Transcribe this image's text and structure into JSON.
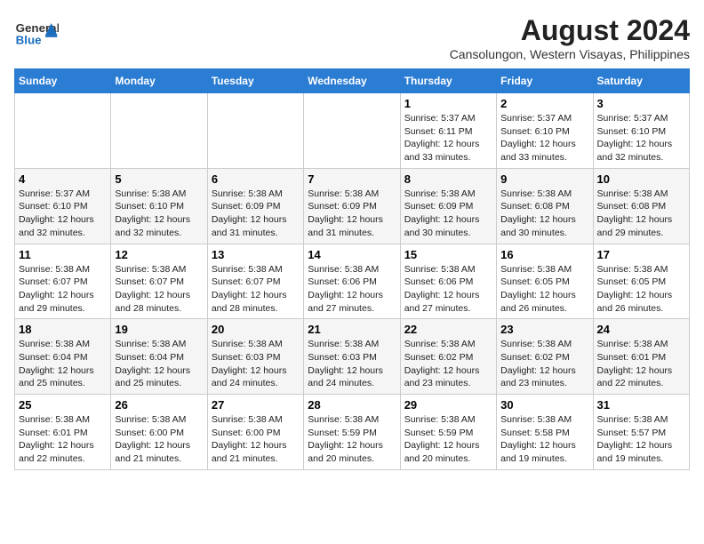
{
  "header": {
    "logo_general": "General",
    "logo_blue": "Blue",
    "month_year": "August 2024",
    "location": "Cansolungon, Western Visayas, Philippines"
  },
  "weekdays": [
    "Sunday",
    "Monday",
    "Tuesday",
    "Wednesday",
    "Thursday",
    "Friday",
    "Saturday"
  ],
  "weeks": [
    [
      {
        "day": "",
        "info": ""
      },
      {
        "day": "",
        "info": ""
      },
      {
        "day": "",
        "info": ""
      },
      {
        "day": "",
        "info": ""
      },
      {
        "day": "1",
        "info": "Sunrise: 5:37 AM\nSunset: 6:11 PM\nDaylight: 12 hours\nand 33 minutes."
      },
      {
        "day": "2",
        "info": "Sunrise: 5:37 AM\nSunset: 6:10 PM\nDaylight: 12 hours\nand 33 minutes."
      },
      {
        "day": "3",
        "info": "Sunrise: 5:37 AM\nSunset: 6:10 PM\nDaylight: 12 hours\nand 32 minutes."
      }
    ],
    [
      {
        "day": "4",
        "info": "Sunrise: 5:37 AM\nSunset: 6:10 PM\nDaylight: 12 hours\nand 32 minutes."
      },
      {
        "day": "5",
        "info": "Sunrise: 5:38 AM\nSunset: 6:10 PM\nDaylight: 12 hours\nand 32 minutes."
      },
      {
        "day": "6",
        "info": "Sunrise: 5:38 AM\nSunset: 6:09 PM\nDaylight: 12 hours\nand 31 minutes."
      },
      {
        "day": "7",
        "info": "Sunrise: 5:38 AM\nSunset: 6:09 PM\nDaylight: 12 hours\nand 31 minutes."
      },
      {
        "day": "8",
        "info": "Sunrise: 5:38 AM\nSunset: 6:09 PM\nDaylight: 12 hours\nand 30 minutes."
      },
      {
        "day": "9",
        "info": "Sunrise: 5:38 AM\nSunset: 6:08 PM\nDaylight: 12 hours\nand 30 minutes."
      },
      {
        "day": "10",
        "info": "Sunrise: 5:38 AM\nSunset: 6:08 PM\nDaylight: 12 hours\nand 29 minutes."
      }
    ],
    [
      {
        "day": "11",
        "info": "Sunrise: 5:38 AM\nSunset: 6:07 PM\nDaylight: 12 hours\nand 29 minutes."
      },
      {
        "day": "12",
        "info": "Sunrise: 5:38 AM\nSunset: 6:07 PM\nDaylight: 12 hours\nand 28 minutes."
      },
      {
        "day": "13",
        "info": "Sunrise: 5:38 AM\nSunset: 6:07 PM\nDaylight: 12 hours\nand 28 minutes."
      },
      {
        "day": "14",
        "info": "Sunrise: 5:38 AM\nSunset: 6:06 PM\nDaylight: 12 hours\nand 27 minutes."
      },
      {
        "day": "15",
        "info": "Sunrise: 5:38 AM\nSunset: 6:06 PM\nDaylight: 12 hours\nand 27 minutes."
      },
      {
        "day": "16",
        "info": "Sunrise: 5:38 AM\nSunset: 6:05 PM\nDaylight: 12 hours\nand 26 minutes."
      },
      {
        "day": "17",
        "info": "Sunrise: 5:38 AM\nSunset: 6:05 PM\nDaylight: 12 hours\nand 26 minutes."
      }
    ],
    [
      {
        "day": "18",
        "info": "Sunrise: 5:38 AM\nSunset: 6:04 PM\nDaylight: 12 hours\nand 25 minutes."
      },
      {
        "day": "19",
        "info": "Sunrise: 5:38 AM\nSunset: 6:04 PM\nDaylight: 12 hours\nand 25 minutes."
      },
      {
        "day": "20",
        "info": "Sunrise: 5:38 AM\nSunset: 6:03 PM\nDaylight: 12 hours\nand 24 minutes."
      },
      {
        "day": "21",
        "info": "Sunrise: 5:38 AM\nSunset: 6:03 PM\nDaylight: 12 hours\nand 24 minutes."
      },
      {
        "day": "22",
        "info": "Sunrise: 5:38 AM\nSunset: 6:02 PM\nDaylight: 12 hours\nand 23 minutes."
      },
      {
        "day": "23",
        "info": "Sunrise: 5:38 AM\nSunset: 6:02 PM\nDaylight: 12 hours\nand 23 minutes."
      },
      {
        "day": "24",
        "info": "Sunrise: 5:38 AM\nSunset: 6:01 PM\nDaylight: 12 hours\nand 22 minutes."
      }
    ],
    [
      {
        "day": "25",
        "info": "Sunrise: 5:38 AM\nSunset: 6:01 PM\nDaylight: 12 hours\nand 22 minutes."
      },
      {
        "day": "26",
        "info": "Sunrise: 5:38 AM\nSunset: 6:00 PM\nDaylight: 12 hours\nand 21 minutes."
      },
      {
        "day": "27",
        "info": "Sunrise: 5:38 AM\nSunset: 6:00 PM\nDaylight: 12 hours\nand 21 minutes."
      },
      {
        "day": "28",
        "info": "Sunrise: 5:38 AM\nSunset: 5:59 PM\nDaylight: 12 hours\nand 20 minutes."
      },
      {
        "day": "29",
        "info": "Sunrise: 5:38 AM\nSunset: 5:59 PM\nDaylight: 12 hours\nand 20 minutes."
      },
      {
        "day": "30",
        "info": "Sunrise: 5:38 AM\nSunset: 5:58 PM\nDaylight: 12 hours\nand 19 minutes."
      },
      {
        "day": "31",
        "info": "Sunrise: 5:38 AM\nSunset: 5:57 PM\nDaylight: 12 hours\nand 19 minutes."
      }
    ]
  ]
}
